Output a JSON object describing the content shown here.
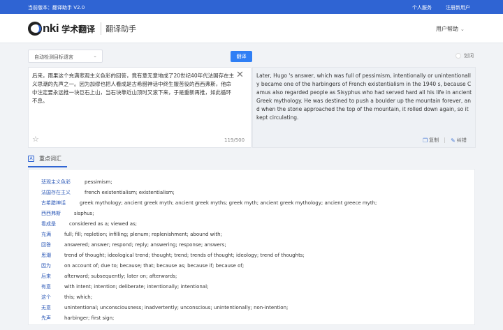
{
  "topbar": {
    "version": "当前版本：翻译助手 V2.0",
    "personal_center": "个人服务",
    "register": "注册新用户"
  },
  "header": {
    "logo_letters": "nki",
    "logo_cn": "学术翻译",
    "subtitle": "翻译助手",
    "help": "用户帮助"
  },
  "controls": {
    "target_lang": "自动检测目标语言",
    "translate_btn": "翻译",
    "mark_label": "划词"
  },
  "source": {
    "text": "后来，雨果这个充满悲观主义色彩的回答，竟有意无意地成了20世纪40年代法国存在主义思潮的先声之一。因为加缪也把人看成是古希腊神话中终生服苦役的西西弗斯，他命中注定要永远推一块巨石上山，当石块靠近山顶时又滚下来，于是重新再推，如此循环不息。",
    "char_count": "119/500"
  },
  "target": {
    "text": "Later, Hugo 's answer, which was full of pessimism, intentionally or unintentionally became one of the harbingers of French existentialism in the 1940 s, because Camus also regarded people as Sisyphus who had served hard all his life in ancient Greek mythology. He was destined to push a boulder up the mountain forever, and when the stone approached the top of the mountain, it rolled down again, so it kept circulating.",
    "copy_label": "复制",
    "correct_label": "纠错"
  },
  "keywords": {
    "tab_label": "重点词汇",
    "items": [
      {
        "term": "悲观主义色彩",
        "defs": "pessimism;"
      },
      {
        "term": "法国存在主义",
        "defs": "french existentialism;   existentialism;"
      },
      {
        "term": "古希腊神话",
        "defs": "greek mythology;   ancient greek myth;   ancient greek myths;   greek myth;   ancient greek mythology;   ancient greece myth;"
      },
      {
        "term": "西西弗斯",
        "defs": "sisphus;"
      },
      {
        "term": "看成是",
        "defs": "considered as a;   viewed as;"
      },
      {
        "term": "充满",
        "defs": "full;   fill;   repletion;   infilling;   plenum;   replenishment;   abound with;"
      },
      {
        "term": "回答",
        "defs": "answered;   answer;   respond;   reply;   answering;   response;   answers;"
      },
      {
        "term": "思潮",
        "defs": "trend of thought;   ideological trend;   thought;   trend;   trends of thought;   ideology;   trend of thoughts;"
      },
      {
        "term": "因为",
        "defs": "on account of;   due to;   because;   that;   because as;   because if;   because of;"
      },
      {
        "term": "后来",
        "defs": "afterward;   subsequently;   later on;   afterwards;"
      },
      {
        "term": "有意",
        "defs": "with intent;   intention;   deliberate;   intentionally;   intentional;"
      },
      {
        "term": "这个",
        "defs": "this;   which;"
      },
      {
        "term": "无意",
        "defs": "unintentional;   unconsciousness;   inadvertently;   unconscious;   unintentionally;   non-intention;"
      },
      {
        "term": "先声",
        "defs": "harbinger;   first sign;"
      }
    ]
  }
}
